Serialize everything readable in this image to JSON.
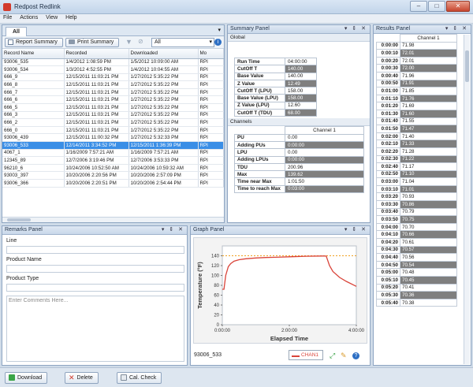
{
  "window": {
    "title": "Redpost Redlink"
  },
  "menu": [
    "File",
    "Actions",
    "View",
    "Help"
  ],
  "records": {
    "tab": "All",
    "report_summary": "Report Summary",
    "print_summary": "Print Summary",
    "filter_value": "All",
    "columns": [
      "Record Name",
      "Recorded",
      "Downloaded",
      "Mo"
    ],
    "rows": [
      [
        "93006_535",
        "1/4/2012 1:08:59 PM",
        "1/5/2012 10:09:00 AM",
        "RPI"
      ],
      [
        "93006_534",
        "1/3/2012 4:52:55 PM",
        "1/4/2012 10:04:55 AM",
        "RPI"
      ],
      [
        "666_9",
        "12/15/2011 11:03:21 PM",
        "1/27/2012 5:35:22 PM",
        "RPI"
      ],
      [
        "666_8",
        "12/15/2011 11:03:21 PM",
        "1/27/2012 5:35:22 PM",
        "RPI"
      ],
      [
        "666_7",
        "12/15/2011 11:03:21 PM",
        "1/27/2012 5:35:22 PM",
        "RPI"
      ],
      [
        "666_6",
        "12/15/2011 11:03:21 PM",
        "1/27/2012 5:35:22 PM",
        "RPI"
      ],
      [
        "666_5",
        "12/15/2011 11:03:21 PM",
        "1/27/2012 5:35:22 PM",
        "RPI"
      ],
      [
        "666_3",
        "12/15/2011 11:03:21 PM",
        "1/27/2012 5:35:22 PM",
        "RPI"
      ],
      [
        "666_2",
        "12/15/2011 11:03:21 PM",
        "1/27/2012 5:35:22 PM",
        "RPI"
      ],
      [
        "666_0",
        "12/15/2011 11:03:21 PM",
        "1/27/2012 5:35:22 PM",
        "RPI"
      ],
      [
        "93006_439",
        "12/15/2011 11:00:32 PM",
        "1/27/2012 5:32:33 PM",
        "RPI"
      ],
      [
        "93006_533",
        "12/14/2011 3:34:52 PM",
        "12/15/2011 1:36:39 PM",
        "RPI"
      ],
      [
        "4067_1",
        "1/16/2009 7:57:21 AM",
        "1/16/2009 7:57:21 AM",
        "RPI"
      ],
      [
        "12345_89",
        "12/7/2006 3:19:46 PM",
        "12/7/2006 3:53:33 PM",
        "RPI"
      ],
      [
        "96210_6",
        "10/24/2006 10:52:50 AM",
        "10/24/2006 10:59:32 AM",
        "RPI"
      ],
      [
        "93003_397",
        "10/20/2006 2:20:56 PM",
        "10/20/2006 2:57:09 PM",
        "RPI"
      ],
      [
        "93006_366",
        "10/20/2006 2:20:51 PM",
        "10/20/2006 2:54:44 PM",
        "RPI"
      ]
    ],
    "selected_index": 11
  },
  "summary": {
    "title": "Summary Panel",
    "global_label": "Global",
    "global": [
      [
        "Run Time",
        "04:00:00",
        false
      ],
      [
        "CutOff T",
        "140.00",
        true
      ],
      [
        "Base Value",
        "140.00",
        false
      ],
      [
        "Z Value",
        "12.49",
        true
      ],
      [
        "CutOff T (LPU)",
        "158.00",
        false
      ],
      [
        "Base Value (LPU)",
        "158.00",
        true
      ],
      [
        "Z Value (LPU)",
        "12.60",
        false
      ],
      [
        "CutOff T (TDU)",
        "68.00",
        true
      ]
    ],
    "channels_label": "Channels",
    "channel_header": "Channel 1",
    "channels": [
      [
        "PU",
        "0.00",
        false
      ],
      [
        "Adding PUs",
        "0:00:00",
        true
      ],
      [
        "LPU",
        "0.00",
        false
      ],
      [
        "Adding LPUs",
        "0:00:00",
        true
      ],
      [
        "TDU",
        "200.96",
        false
      ],
      [
        "Max",
        "139.62",
        true
      ],
      [
        "Time near Max",
        "1:01:50",
        false
      ],
      [
        "Time to reach Max",
        "0:03:00",
        true
      ]
    ]
  },
  "results": {
    "title": "Results Panel",
    "channel_header": "Channel 1",
    "rows": [
      [
        "0:00:00",
        "71.98",
        false
      ],
      [
        "0:00:10",
        "72.01",
        true
      ],
      [
        "0:00:20",
        "72.01",
        false
      ],
      [
        "0:00:30",
        "72.00",
        true
      ],
      [
        "0:00:40",
        "71.96",
        false
      ],
      [
        "0:00:50",
        "71.91",
        true
      ],
      [
        "0:01:00",
        "71.85",
        false
      ],
      [
        "0:01:10",
        "71.76",
        true
      ],
      [
        "0:01:20",
        "71.69",
        false
      ],
      [
        "0:01:30",
        "71.60",
        true
      ],
      [
        "0:01:40",
        "71.55",
        false
      ],
      [
        "0:01:50",
        "71.47",
        true
      ],
      [
        "0:02:00",
        "71.40",
        false
      ],
      [
        "0:02:10",
        "71.33",
        true
      ],
      [
        "0:02:20",
        "71.28",
        false
      ],
      [
        "0:02:30",
        "71.22",
        true
      ],
      [
        "0:02:40",
        "71.17",
        false
      ],
      [
        "0:02:50",
        "71.10",
        true
      ],
      [
        "0:03:00",
        "71.04",
        false
      ],
      [
        "0:03:10",
        "71.01",
        true
      ],
      [
        "0:03:20",
        "70.93",
        false
      ],
      [
        "0:03:30",
        "70.86",
        true
      ],
      [
        "0:03:40",
        "70.79",
        false
      ],
      [
        "0:03:50",
        "70.75",
        true
      ],
      [
        "0:04:00",
        "70.70",
        false
      ],
      [
        "0:04:10",
        "70.66",
        true
      ],
      [
        "0:04:20",
        "70.61",
        false
      ],
      [
        "0:04:30",
        "70.57",
        true
      ],
      [
        "0:04:40",
        "70.56",
        false
      ],
      [
        "0:04:50",
        "70.54",
        true
      ],
      [
        "0:05:00",
        "70.48",
        false
      ],
      [
        "0:05:10",
        "70.45",
        true
      ],
      [
        "0:05:20",
        "70.41",
        false
      ],
      [
        "0:05:30",
        "70.36",
        true
      ],
      [
        "0:05:40",
        "70.38",
        false
      ]
    ]
  },
  "remarks": {
    "title": "Remarks Panel",
    "fields": [
      "Line",
      "Product Name",
      "Product Type"
    ],
    "comments_placeholder": "Enter Comments Here..."
  },
  "graph": {
    "title": "Graph Panel",
    "record_name": "93006_533",
    "legend": "CHAN1"
  },
  "chart_data": {
    "type": "line",
    "xlabel": "Elapsed Time",
    "ylabel": "Temperature (°F)",
    "x_tick_labels": [
      "0:00:00",
      "2:00:00",
      "4:00:00"
    ],
    "xlim_hours": [
      0,
      4
    ],
    "ylim": [
      0,
      160
    ],
    "y_ticks": [
      0,
      20,
      40,
      60,
      80,
      100,
      120,
      140
    ],
    "threshold": 140,
    "series": [
      {
        "name": "CHAN1",
        "color": "#d9443a",
        "x_hours": [
          0,
          0.05,
          0.1,
          0.18,
          0.25,
          0.35,
          0.5,
          0.7,
          1.0,
          1.3,
          1.6,
          2.0,
          2.5,
          3.0,
          3.1,
          3.2,
          3.3,
          3.5,
          3.7,
          4.0
        ],
        "values": [
          72,
          72,
          100,
          118,
          124,
          129,
          132,
          134,
          135.5,
          136.5,
          137,
          138,
          139,
          139.6,
          139.4,
          120,
          108,
          96,
          88,
          78
        ]
      }
    ],
    "threshold_color": "#f0a020",
    "grid": true
  },
  "bottom": {
    "download": "Download",
    "delete": "Delete",
    "cal_check": "Cal. Check"
  }
}
